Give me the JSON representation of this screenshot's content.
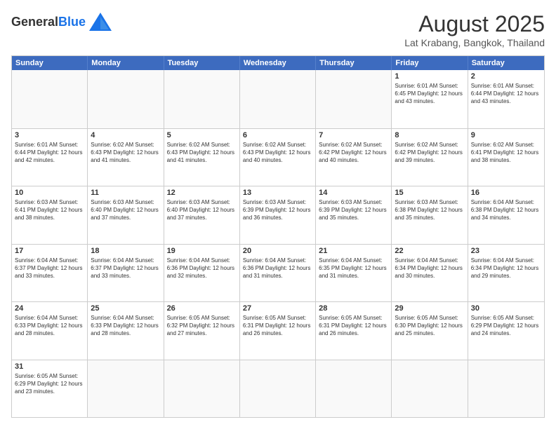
{
  "header": {
    "logo_general": "General",
    "logo_blue": "Blue",
    "month_title": "August 2025",
    "location": "Lat Krabang, Bangkok, Thailand"
  },
  "weekdays": [
    "Sunday",
    "Monday",
    "Tuesday",
    "Wednesday",
    "Thursday",
    "Friday",
    "Saturday"
  ],
  "weeks": [
    [
      {
        "day": "",
        "empty": true,
        "info": ""
      },
      {
        "day": "",
        "empty": true,
        "info": ""
      },
      {
        "day": "",
        "empty": true,
        "info": ""
      },
      {
        "day": "",
        "empty": true,
        "info": ""
      },
      {
        "day": "",
        "empty": true,
        "info": ""
      },
      {
        "day": "1",
        "empty": false,
        "info": "Sunrise: 6:01 AM\nSunset: 6:45 PM\nDaylight: 12 hours\nand 43 minutes."
      },
      {
        "day": "2",
        "empty": false,
        "info": "Sunrise: 6:01 AM\nSunset: 6:44 PM\nDaylight: 12 hours\nand 43 minutes."
      }
    ],
    [
      {
        "day": "3",
        "empty": false,
        "info": "Sunrise: 6:01 AM\nSunset: 6:44 PM\nDaylight: 12 hours\nand 42 minutes."
      },
      {
        "day": "4",
        "empty": false,
        "info": "Sunrise: 6:02 AM\nSunset: 6:43 PM\nDaylight: 12 hours\nand 41 minutes."
      },
      {
        "day": "5",
        "empty": false,
        "info": "Sunrise: 6:02 AM\nSunset: 6:43 PM\nDaylight: 12 hours\nand 41 minutes."
      },
      {
        "day": "6",
        "empty": false,
        "info": "Sunrise: 6:02 AM\nSunset: 6:43 PM\nDaylight: 12 hours\nand 40 minutes."
      },
      {
        "day": "7",
        "empty": false,
        "info": "Sunrise: 6:02 AM\nSunset: 6:42 PM\nDaylight: 12 hours\nand 40 minutes."
      },
      {
        "day": "8",
        "empty": false,
        "info": "Sunrise: 6:02 AM\nSunset: 6:42 PM\nDaylight: 12 hours\nand 39 minutes."
      },
      {
        "day": "9",
        "empty": false,
        "info": "Sunrise: 6:02 AM\nSunset: 6:41 PM\nDaylight: 12 hours\nand 38 minutes."
      }
    ],
    [
      {
        "day": "10",
        "empty": false,
        "info": "Sunrise: 6:03 AM\nSunset: 6:41 PM\nDaylight: 12 hours\nand 38 minutes."
      },
      {
        "day": "11",
        "empty": false,
        "info": "Sunrise: 6:03 AM\nSunset: 6:40 PM\nDaylight: 12 hours\nand 37 minutes."
      },
      {
        "day": "12",
        "empty": false,
        "info": "Sunrise: 6:03 AM\nSunset: 6:40 PM\nDaylight: 12 hours\nand 37 minutes."
      },
      {
        "day": "13",
        "empty": false,
        "info": "Sunrise: 6:03 AM\nSunset: 6:39 PM\nDaylight: 12 hours\nand 36 minutes."
      },
      {
        "day": "14",
        "empty": false,
        "info": "Sunrise: 6:03 AM\nSunset: 6:39 PM\nDaylight: 12 hours\nand 35 minutes."
      },
      {
        "day": "15",
        "empty": false,
        "info": "Sunrise: 6:03 AM\nSunset: 6:38 PM\nDaylight: 12 hours\nand 35 minutes."
      },
      {
        "day": "16",
        "empty": false,
        "info": "Sunrise: 6:04 AM\nSunset: 6:38 PM\nDaylight: 12 hours\nand 34 minutes."
      }
    ],
    [
      {
        "day": "17",
        "empty": false,
        "info": "Sunrise: 6:04 AM\nSunset: 6:37 PM\nDaylight: 12 hours\nand 33 minutes."
      },
      {
        "day": "18",
        "empty": false,
        "info": "Sunrise: 6:04 AM\nSunset: 6:37 PM\nDaylight: 12 hours\nand 33 minutes."
      },
      {
        "day": "19",
        "empty": false,
        "info": "Sunrise: 6:04 AM\nSunset: 6:36 PM\nDaylight: 12 hours\nand 32 minutes."
      },
      {
        "day": "20",
        "empty": false,
        "info": "Sunrise: 6:04 AM\nSunset: 6:36 PM\nDaylight: 12 hours\nand 31 minutes."
      },
      {
        "day": "21",
        "empty": false,
        "info": "Sunrise: 6:04 AM\nSunset: 6:35 PM\nDaylight: 12 hours\nand 31 minutes."
      },
      {
        "day": "22",
        "empty": false,
        "info": "Sunrise: 6:04 AM\nSunset: 6:34 PM\nDaylight: 12 hours\nand 30 minutes."
      },
      {
        "day": "23",
        "empty": false,
        "info": "Sunrise: 6:04 AM\nSunset: 6:34 PM\nDaylight: 12 hours\nand 29 minutes."
      }
    ],
    [
      {
        "day": "24",
        "empty": false,
        "info": "Sunrise: 6:04 AM\nSunset: 6:33 PM\nDaylight: 12 hours\nand 28 minutes."
      },
      {
        "day": "25",
        "empty": false,
        "info": "Sunrise: 6:04 AM\nSunset: 6:33 PM\nDaylight: 12 hours\nand 28 minutes."
      },
      {
        "day": "26",
        "empty": false,
        "info": "Sunrise: 6:05 AM\nSunset: 6:32 PM\nDaylight: 12 hours\nand 27 minutes."
      },
      {
        "day": "27",
        "empty": false,
        "info": "Sunrise: 6:05 AM\nSunset: 6:31 PM\nDaylight: 12 hours\nand 26 minutes."
      },
      {
        "day": "28",
        "empty": false,
        "info": "Sunrise: 6:05 AM\nSunset: 6:31 PM\nDaylight: 12 hours\nand 26 minutes."
      },
      {
        "day": "29",
        "empty": false,
        "info": "Sunrise: 6:05 AM\nSunset: 6:30 PM\nDaylight: 12 hours\nand 25 minutes."
      },
      {
        "day": "30",
        "empty": false,
        "info": "Sunrise: 6:05 AM\nSunset: 6:29 PM\nDaylight: 12 hours\nand 24 minutes."
      }
    ],
    [
      {
        "day": "31",
        "empty": false,
        "info": "Sunrise: 6:05 AM\nSunset: 6:29 PM\nDaylight: 12 hours\nand 23 minutes."
      },
      {
        "day": "",
        "empty": true,
        "info": ""
      },
      {
        "day": "",
        "empty": true,
        "info": ""
      },
      {
        "day": "",
        "empty": true,
        "info": ""
      },
      {
        "day": "",
        "empty": true,
        "info": ""
      },
      {
        "day": "",
        "empty": true,
        "info": ""
      },
      {
        "day": "",
        "empty": true,
        "info": ""
      }
    ]
  ]
}
